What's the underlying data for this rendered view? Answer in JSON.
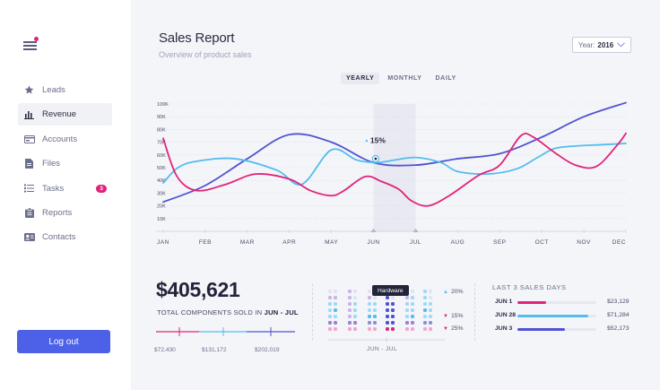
{
  "sidebar": {
    "items": [
      {
        "label": "Leads",
        "icon": "star-icon",
        "active": false
      },
      {
        "label": "Revenue",
        "icon": "bar-chart-icon",
        "active": true
      },
      {
        "label": "Accounts",
        "icon": "card-icon",
        "active": false
      },
      {
        "label": "Files",
        "icon": "file-icon",
        "active": false
      },
      {
        "label": "Tasks",
        "icon": "tasks-icon",
        "active": false,
        "badge": "3"
      },
      {
        "label": "Reports",
        "icon": "clipboard-icon",
        "active": false
      },
      {
        "label": "Contacts",
        "icon": "contact-card-icon",
        "active": false
      }
    ],
    "logout_label": "Log out"
  },
  "header": {
    "title": "Sales Report",
    "subtitle": "Overview of product sales",
    "year_label": "Year:",
    "year_value": "2016"
  },
  "tabs": [
    {
      "label": "YEARLY",
      "active": true
    },
    {
      "label": "MONTHLY",
      "active": false
    },
    {
      "label": "DAILY",
      "active": false
    }
  ],
  "colors": {
    "blue": "#5053d0",
    "cyan": "#52bdee",
    "pink": "#e0237a",
    "accent": "#4c60e8"
  },
  "chart_data": {
    "type": "line",
    "categories": [
      "JAN",
      "FEB",
      "MAR",
      "APR",
      "MAY",
      "JUN",
      "JUL",
      "AUG",
      "SEP",
      "OCT",
      "NOV",
      "DEC"
    ],
    "y_tick_labels": [
      "10K",
      "20K",
      "30K",
      "40K",
      "50K",
      "60K",
      "70K",
      "80K",
      "90K",
      "100K"
    ],
    "ylim": [
      0,
      100
    ],
    "grid": true,
    "series": [
      {
        "color": "#5053d0",
        "x": [
          0,
          1,
          2,
          3,
          4,
          5,
          6,
          7,
          8,
          9,
          10,
          11
        ],
        "values": [
          23,
          36,
          57,
          76,
          70,
          54,
          52,
          57,
          61,
          74,
          90,
          101
        ]
      },
      {
        "color": "#52bdee",
        "x": [
          0,
          0.35,
          0.8,
          1.7,
          2.7,
          3.3,
          4.0,
          4.6,
          5.1,
          5.5,
          6.0,
          6.6,
          7.0,
          7.7,
          8.4,
          8.9,
          9.3,
          9.8,
          10.4,
          11.0
        ],
        "values": [
          38,
          50,
          55,
          57,
          48,
          37,
          64,
          56,
          54,
          56,
          58,
          54,
          47,
          45,
          49,
          58,
          65,
          67,
          68,
          69
        ]
      },
      {
        "color": "#e0237a",
        "x": [
          0,
          0.33,
          0.8,
          1.5,
          2.2,
          3.0,
          3.5,
          4.0,
          4.3,
          4.8,
          5.2,
          5.6,
          5.9,
          6.3,
          6.8,
          7.5,
          8.0,
          8.5,
          8.8,
          9.3,
          9.8,
          10.3,
          10.8,
          11.0
        ],
        "values": [
          73,
          43,
          32,
          37,
          45,
          41,
          32,
          28,
          32,
          43,
          39,
          33,
          24,
          20,
          28,
          44,
          52,
          75,
          74,
          62,
          52,
          51,
          68,
          77
        ]
      }
    ],
    "highlight": {
      "category": "JUN",
      "label": "15%"
    }
  },
  "summary": {
    "total": "$405,621",
    "caption_prefix": "TOTAL COMPONENTS SOLD IN",
    "caption_range": "JUN - JUL",
    "segments": [
      {
        "value": "$72,430",
        "color": "#e0237a"
      },
      {
        "value": "$131,172",
        "color": "#52bdee"
      },
      {
        "value": "$202,019",
        "color": "#5053d0"
      }
    ]
  },
  "category_panel": {
    "tooltip": "Hardware",
    "range_label": "JUN - JUL",
    "percents": [
      {
        "value": "20%",
        "direction": "up",
        "color": "#52bdee"
      },
      {
        "value": "15%",
        "direction": "down",
        "color": "#e0237a"
      },
      {
        "value": "25%",
        "direction": "down",
        "color": "#e0237a"
      }
    ]
  },
  "last_days": {
    "title": "LAST 3 SALES DAYS",
    "rows": [
      {
        "label": "JUN 1",
        "value": "$23,129",
        "fill": 0.36,
        "color": "#e0237a"
      },
      {
        "label": "JUN 28",
        "value": "$71,284",
        "fill": 0.9,
        "color": "#52bdee"
      },
      {
        "label": "JUN 3",
        "value": "$52,173",
        "fill": 0.6,
        "color": "#5053d0"
      }
    ]
  }
}
